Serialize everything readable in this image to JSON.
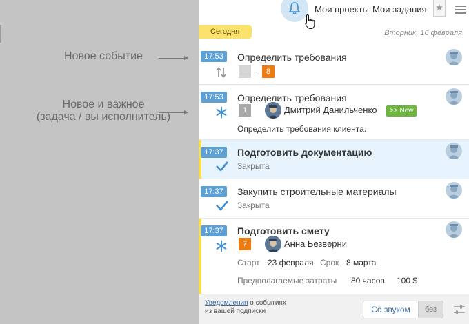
{
  "annotations": {
    "new_event": "Новое событие",
    "new_important_line1": "Новое и важное",
    "new_important_line2": "(задача / вы исполнитель)"
  },
  "topbar": {
    "my_projects": "Мои проекты",
    "my_tasks": "Мои задания",
    "star_glyph": "★"
  },
  "date_row": {
    "today_label": "Сегодня",
    "date_label": "Вторник, 16 февраля"
  },
  "feed": [
    {
      "time": "17:53",
      "title": "Определить требования",
      "icon": "swap-arrows-icon",
      "badge_old": "",
      "badge_new": "8"
    },
    {
      "time": "17:53",
      "title": "Определить требования",
      "icon": "spark-icon",
      "badge": "1",
      "user_name": "Дмитрий Данильченко",
      "new_label": ">> New",
      "description": "Определить требования клиента."
    },
    {
      "time": "17:37",
      "title": "Подготовить документацию",
      "icon": "check-icon",
      "status": "Закрыта"
    },
    {
      "time": "17:37",
      "title": "Закупить строительные материалы",
      "icon": "check-icon",
      "status": "Закрыта"
    },
    {
      "time": "17:37",
      "title": "Подготовить смету",
      "icon": "spark-icon",
      "badge": "7",
      "user_name": "Анна Безверни",
      "start_label": "Старт",
      "start_value": "23 февраля",
      "due_label": "Срок",
      "due_value": "8 марта",
      "cost_label": "Предполагаемые затраты",
      "hours_value": "80 часов",
      "money_value": "100 $"
    }
  ],
  "footer": {
    "link_text": "Уведомления",
    "rest_line1": " о событиях",
    "line2": "из вашей подписки",
    "sound_on": "Со звуком",
    "sound_off": "без"
  },
  "colors": {
    "time_badge": "#5fa0d3",
    "highlight_bar": "#fbdc4e",
    "new_badge": "#6cb53f",
    "orange_badge": "#ee7a12",
    "selected_row": "#e8f4fd"
  }
}
